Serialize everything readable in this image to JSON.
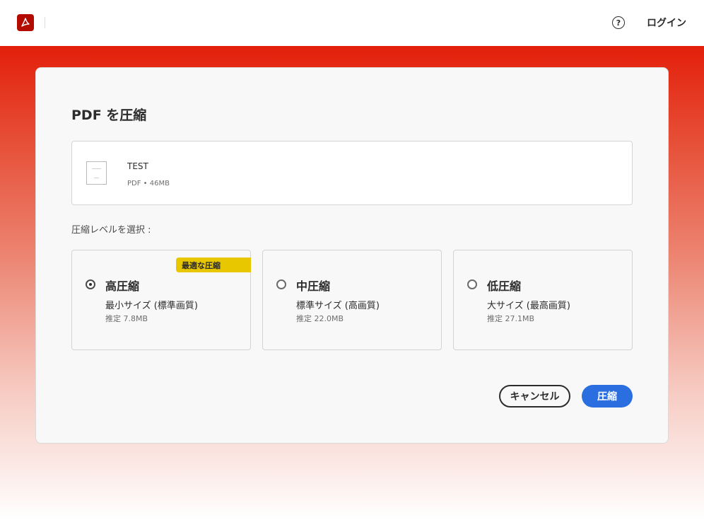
{
  "header": {
    "help_icon": "question-circle-icon",
    "help_glyph": "?",
    "login_label": "ログイン",
    "brand_color": "#b30b00"
  },
  "dialog": {
    "title": "PDF を圧縮",
    "file": {
      "name": "TEST",
      "meta": "PDF • 46MB"
    },
    "level_prompt": "圧縮レベルを選択 :",
    "options": [
      {
        "title": "高圧縮",
        "description": "最小サイズ (標準画質)",
        "estimate": "推定 7.8MB",
        "badge": "最適な圧縮",
        "selected": true
      },
      {
        "title": "中圧縮",
        "description": "標準サイズ (高画質)",
        "estimate": "推定 22.0MB",
        "selected": false
      },
      {
        "title": "低圧縮",
        "description": "大サイズ (最高画質)",
        "estimate": "推定 27.1MB",
        "selected": false
      }
    ],
    "cancel_label": "キャンセル",
    "compress_label": "圧縮",
    "accent_color": "#2b6ee0",
    "badge_color": "#e8c600"
  }
}
